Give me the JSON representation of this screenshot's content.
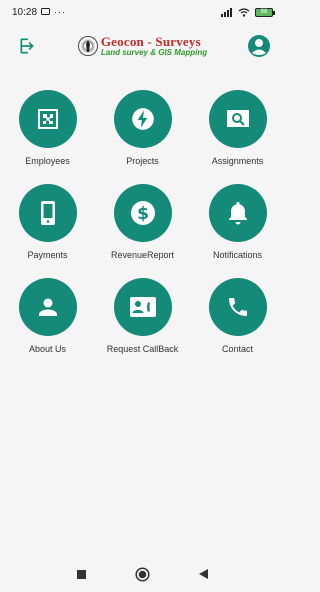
{
  "status": {
    "time": "10:28",
    "battery": "88"
  },
  "header": {
    "title": "Geocon - Surveys",
    "subtitle": "Land survey & GIS Mapping"
  },
  "colors": {
    "accent": "#148a78",
    "brand_red": "#c62828",
    "brand_green": "#2e9b2e"
  },
  "tiles": [
    {
      "label": "Employees",
      "icon": "puzzle-icon"
    },
    {
      "label": "Projects",
      "icon": "bolt-icon"
    },
    {
      "label": "Assignments",
      "icon": "image-search-icon"
    },
    {
      "label": "Payments",
      "icon": "phone-icon"
    },
    {
      "label": "RevenueReport",
      "icon": "dollar-icon"
    },
    {
      "label": "Notifications",
      "icon": "bell-icon"
    },
    {
      "label": "About Us",
      "icon": "person-icon"
    },
    {
      "label": "Request CallBack",
      "icon": "contact-card-icon"
    },
    {
      "label": "Contact",
      "icon": "call-icon"
    }
  ]
}
